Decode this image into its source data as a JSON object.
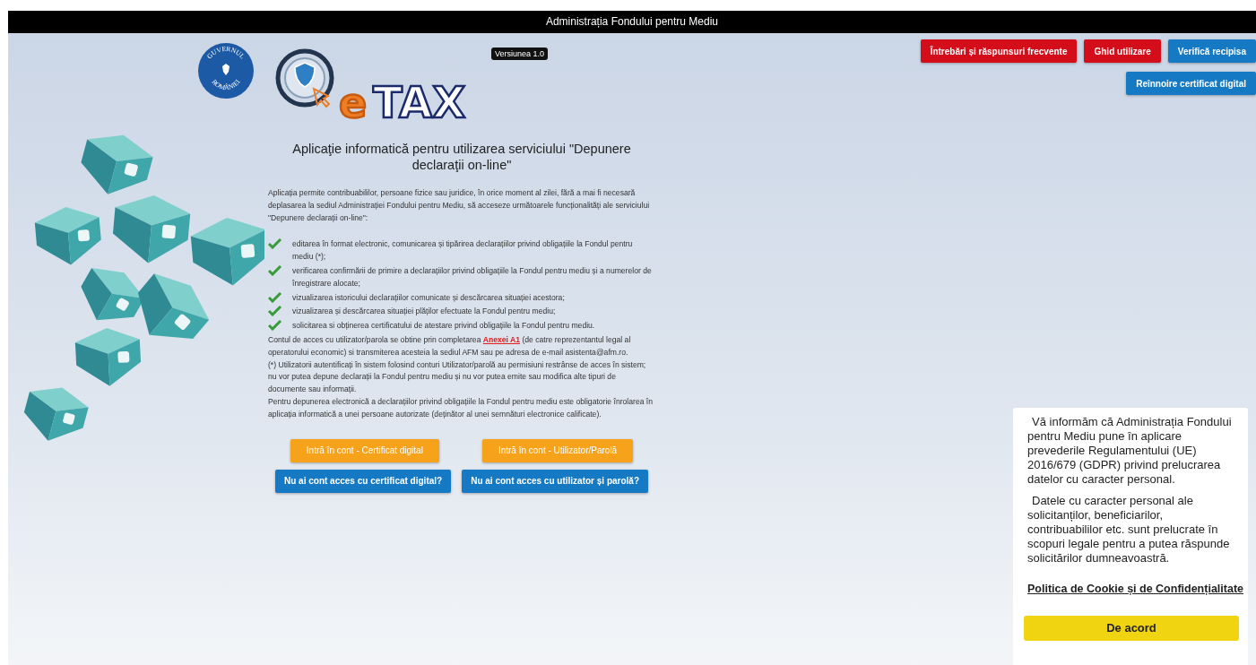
{
  "header": {
    "title": "Administrația Fondului pentru Mediu"
  },
  "logos": {
    "seal_text_top": "GUVERNUL",
    "seal_text_bottom": "ROMÂNIEI",
    "app_prefix": "e",
    "app_name": "TAX"
  },
  "version_badge": "Versiunea 1.0",
  "top_buttons": [
    {
      "label": "Întrebări și răspunsuri frecvente",
      "kind": "danger"
    },
    {
      "label": "Ghid utilizare",
      "kind": "danger"
    },
    {
      "label": "Verifică recipisa",
      "kind": "primary"
    },
    {
      "label": "Reînnoire certificat digital",
      "kind": "primary"
    }
  ],
  "title": "Aplicaţie informatică pentru utilizarea serviciului \"Depunere declaraţii on-line\"",
  "intro": "Aplicația permite contribuabililor, persoane fizice sau juridice, în orice moment al zilei, fără a mai fi necesară deplasarea la sediul Administrației Fondului pentru Mediu, să acceseze următoarele funcționalități ale serviciului \"Depunere declarații on-line\":",
  "features": [
    "editarea în format electronic, comunicarea și tipărirea declarațiilor privind obligațiile la Fondul pentru mediu (*);",
    "verificarea confirmării de primire a declarațiilor privind obligațiile la Fondul pentru mediu și a numerelor de înregistrare alocate;",
    "vizualizarea istoricului declarațiilor comunicate și descărcarea situației acestora;",
    "vizualizarea și descărcarea situației plăților efectuate la Fondul pentru mediu;",
    "solicitarea si obținerea certificatului de atestare privind obligațiile la Fondul pentru mediu."
  ],
  "account_note": {
    "before": "Contul de acces cu utilizator/parola se obtine prin completarea ",
    "link": "Anexei A1",
    "after": " (de catre reprezentantul legal al operatorului economic) si transmiterea acesteia la sediul AFM sau pe adresa de e-mail asistenta@afm.ro."
  },
  "notes": [
    "(*) Utilizatorii autentificați în sistem folosind conturi Utilizator/parolă au permisiuni restrânse de acces în sistem; nu vor putea depune declarații la Fondul pentru mediu și nu vor putea emite sau modifica alte tipuri de documente sau informații.",
    "Pentru depunerea electronică a declarațiilor privind obligațiile la Fondul pentru mediu este obligatorie înrolarea în aplicația informatică a unei persoane autorizate (deținător al unei semnături electronice calificate)."
  ],
  "login_buttons": [
    [
      {
        "label": "Intră în cont - Certificat digital",
        "kind": "warning"
      },
      {
        "label": "Intră în cont - Utilizator/Parolă",
        "kind": "warning"
      }
    ],
    [
      {
        "label": "Nu ai cont acces cu certificat digital?",
        "kind": "primary"
      },
      {
        "label": "Nu ai cont acces cu utilizator și parolă?",
        "kind": "primary"
      }
    ]
  ],
  "cookie_notice": {
    "paragraphs": [
      "Vă informăm că Administrația Fondului pentru Mediu pune în aplicare prevederile Regulamentului (UE) 2016/679 (GDPR) privind prelucrarea datelor cu caracter personal.",
      "Datele cu caracter personal ale solicitanților, beneficiarilor, contribuabililor etc. sunt prelucrate în scopuri legale pentru a putea răspunde solicitărilor dumneavoastră."
    ],
    "policy_link": "Politica de Cookie și de Confidențialitate",
    "accept_button": "De acord"
  }
}
